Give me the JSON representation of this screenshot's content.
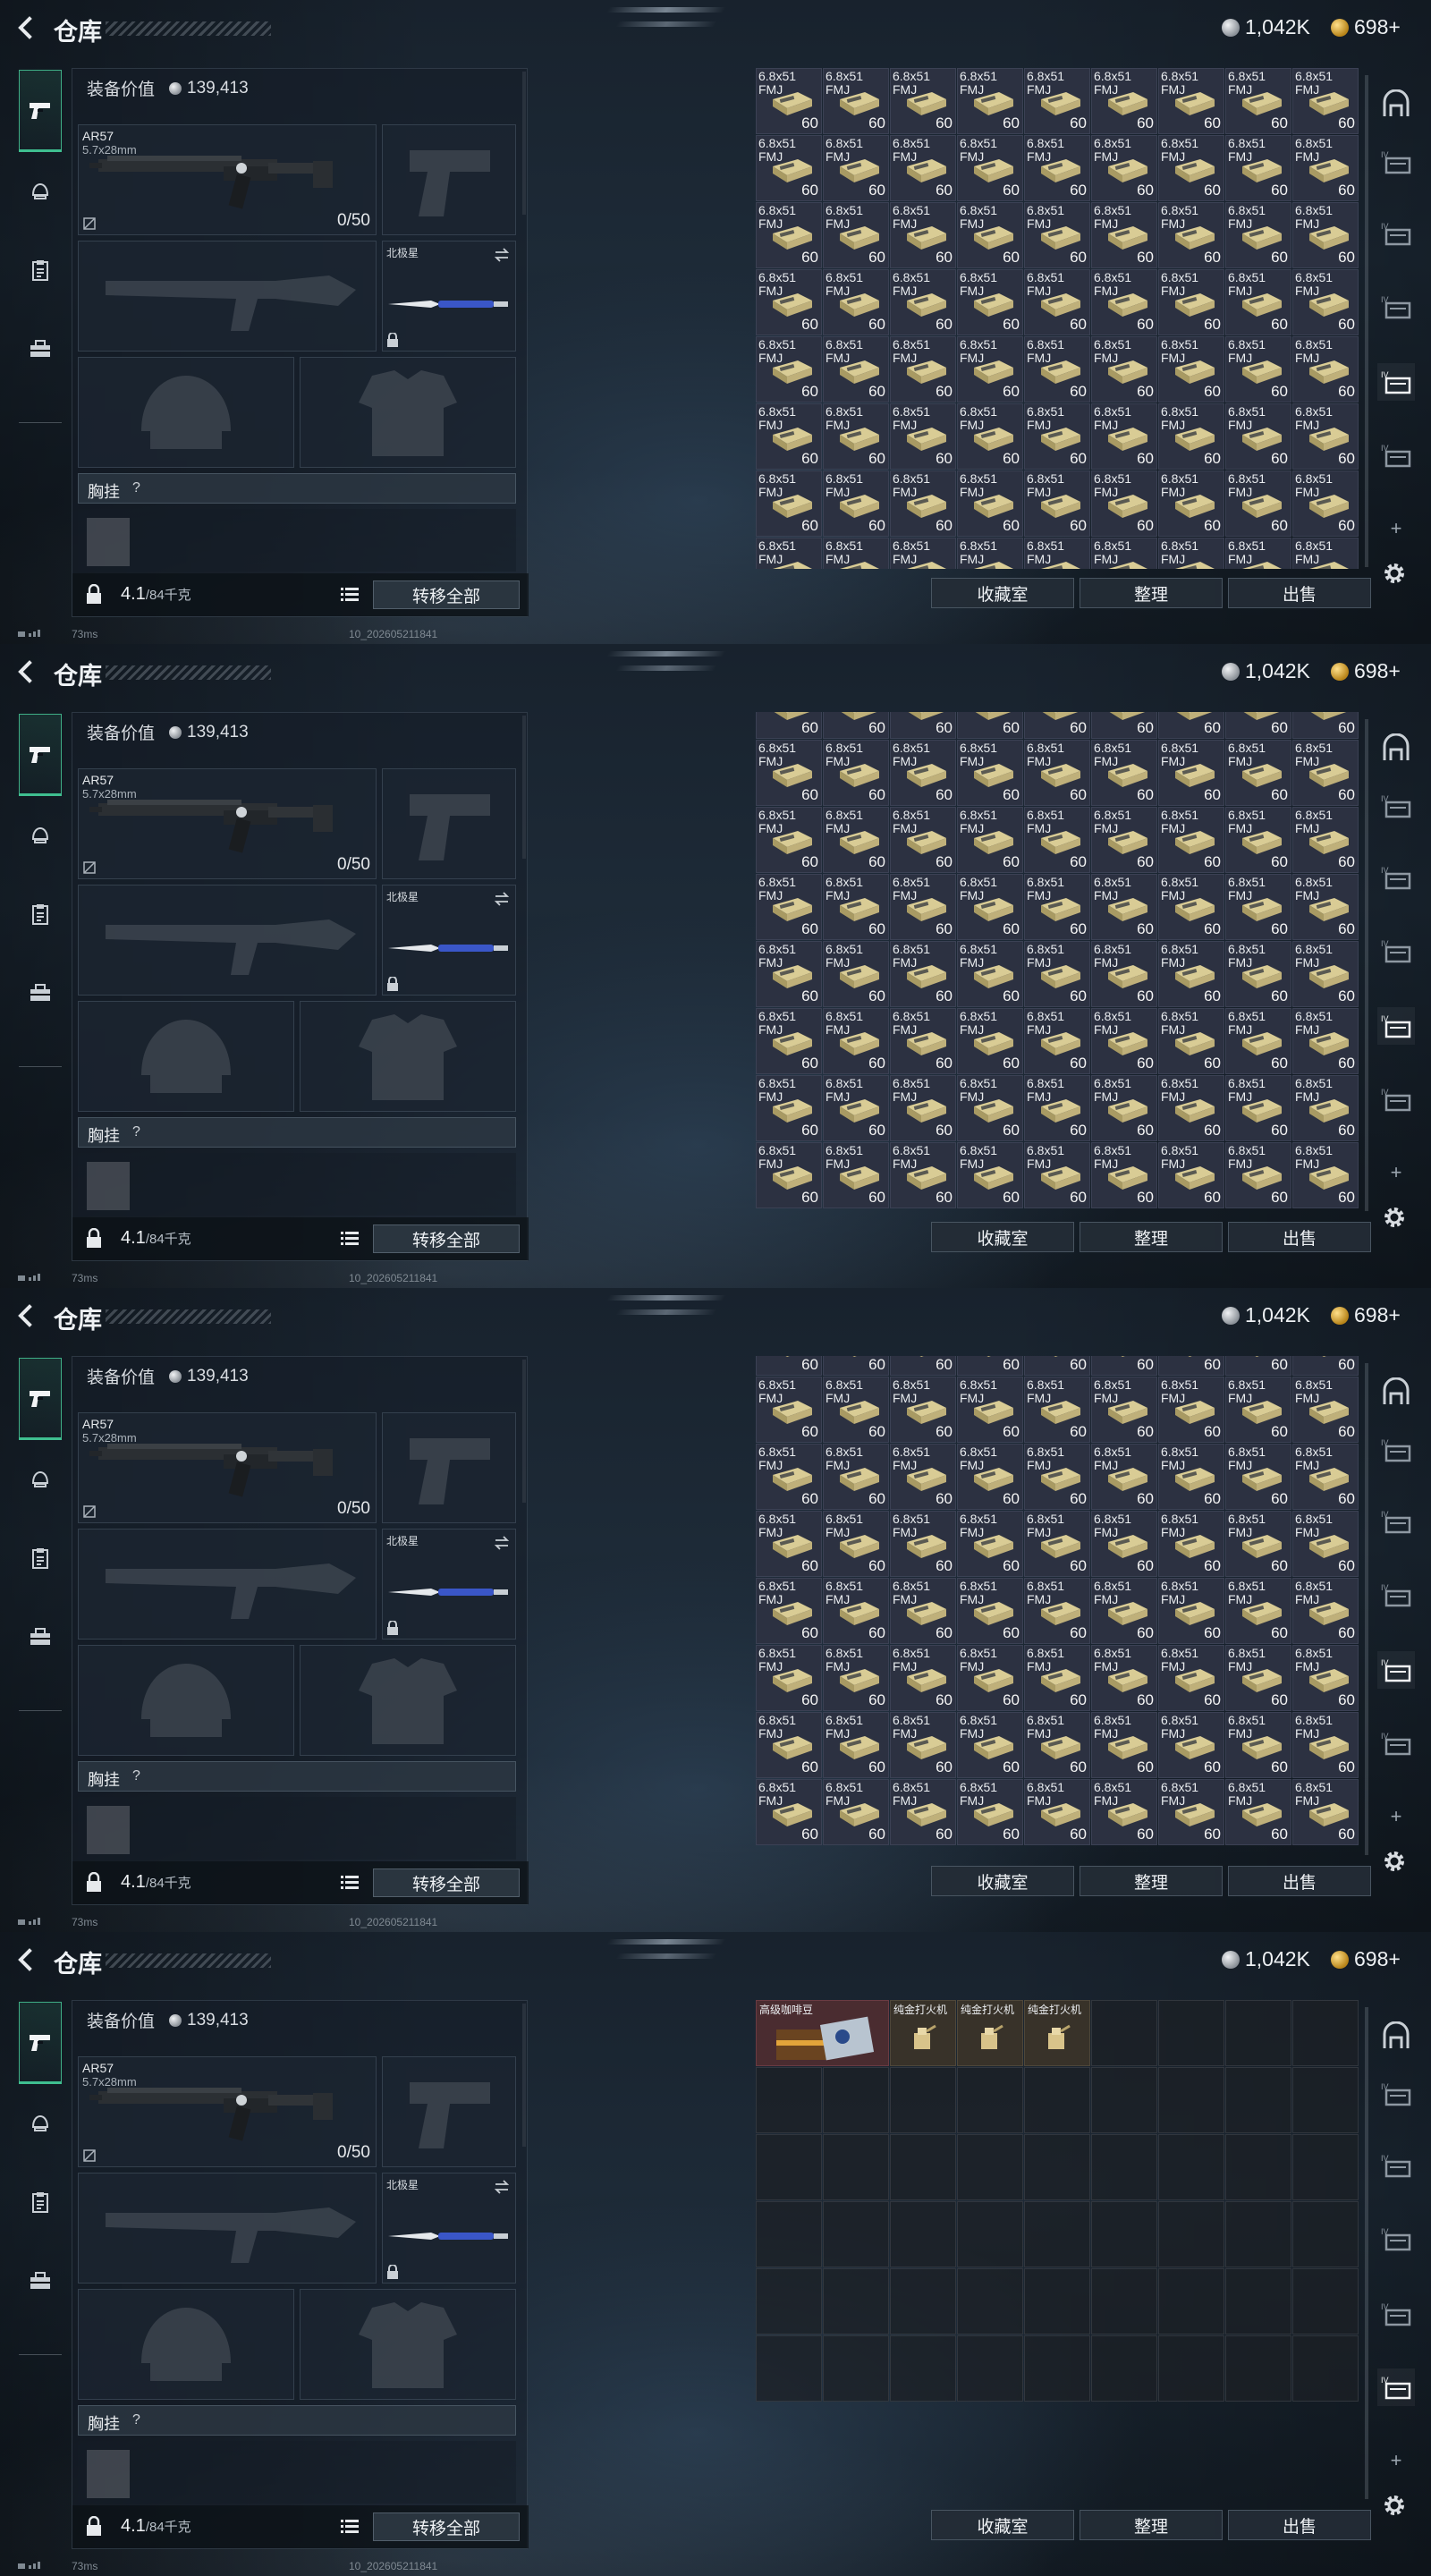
{
  "header": {
    "title": "仓库",
    "silver_amount": "1,042K",
    "gold_amount": "698+"
  },
  "left_nav": [
    "pistol-icon",
    "helmet-icon",
    "clipboard-icon",
    "toolbox-icon"
  ],
  "equipment": {
    "value_label": "装备价值",
    "value_amount": "139,413",
    "primary": {
      "name": "AR57",
      "caliber": "5.7x28mm",
      "ammo": "0/50"
    },
    "melee": {
      "name": "北极星"
    },
    "rig_label": "胸挂",
    "rig_help": "?",
    "weight_value": "4.1",
    "weight_max": "/84千克",
    "transfer_all": "转移全部"
  },
  "storage": {
    "ammo_item": {
      "label_line1": "6.8x51",
      "label_line2": "FMJ",
      "count": "60"
    },
    "special_items": [
      {
        "label": "高级咖啡豆"
      },
      {
        "label": "纯金打火机"
      },
      {
        "label": "纯金打火机"
      },
      {
        "label": "纯金打火机"
      }
    ],
    "buttons": {
      "collection": "收藏室",
      "sort": "整理",
      "sell": "出售"
    }
  },
  "status": {
    "ping": "73ms",
    "build": "10_202605211841"
  },
  "right_nav": [
    "tv-icon-1",
    "tv-icon-2",
    "tv-icon-3",
    "tv-icon-4",
    "tv-icon-5",
    "tv-icon-6"
  ],
  "colors": {
    "accent_green": "#3fae86",
    "ammo_cell": "#2c3141",
    "item_gold": "#383229",
    "item_red": "#4a2c30"
  }
}
